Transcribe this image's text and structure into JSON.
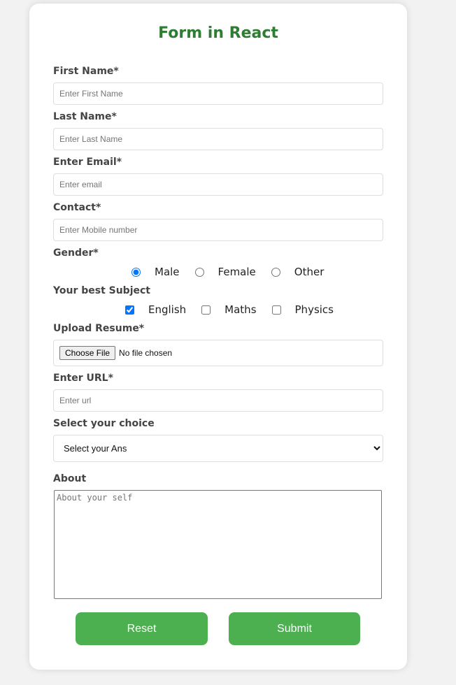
{
  "title": "Form in React",
  "fields": {
    "first_name": {
      "label": "First Name*",
      "placeholder": "Enter First Name"
    },
    "last_name": {
      "label": "Last Name*",
      "placeholder": "Enter Last Name"
    },
    "email": {
      "label": "Enter Email*",
      "placeholder": "Enter email"
    },
    "contact": {
      "label": "Contact*",
      "placeholder": "Enter Mobile number"
    },
    "gender": {
      "label": "Gender*",
      "options": [
        "Male",
        "Female",
        "Other"
      ],
      "selected": "Male"
    },
    "subject": {
      "label": "Your best Subject",
      "options": [
        "English",
        "Maths",
        "Physics"
      ],
      "checked": [
        "English"
      ]
    },
    "resume": {
      "label": "Upload Resume*",
      "button": "Choose File",
      "status": "No file chosen"
    },
    "url": {
      "label": "Enter URL*",
      "placeholder": "Enter url"
    },
    "choice": {
      "label": "Select your choice",
      "selected": "Select your Ans"
    },
    "about": {
      "label": "About",
      "placeholder": "About your self"
    }
  },
  "buttons": {
    "reset": "Reset",
    "submit": "Submit"
  },
  "colors": {
    "title": "#2e7d32",
    "button": "#4caf50"
  }
}
